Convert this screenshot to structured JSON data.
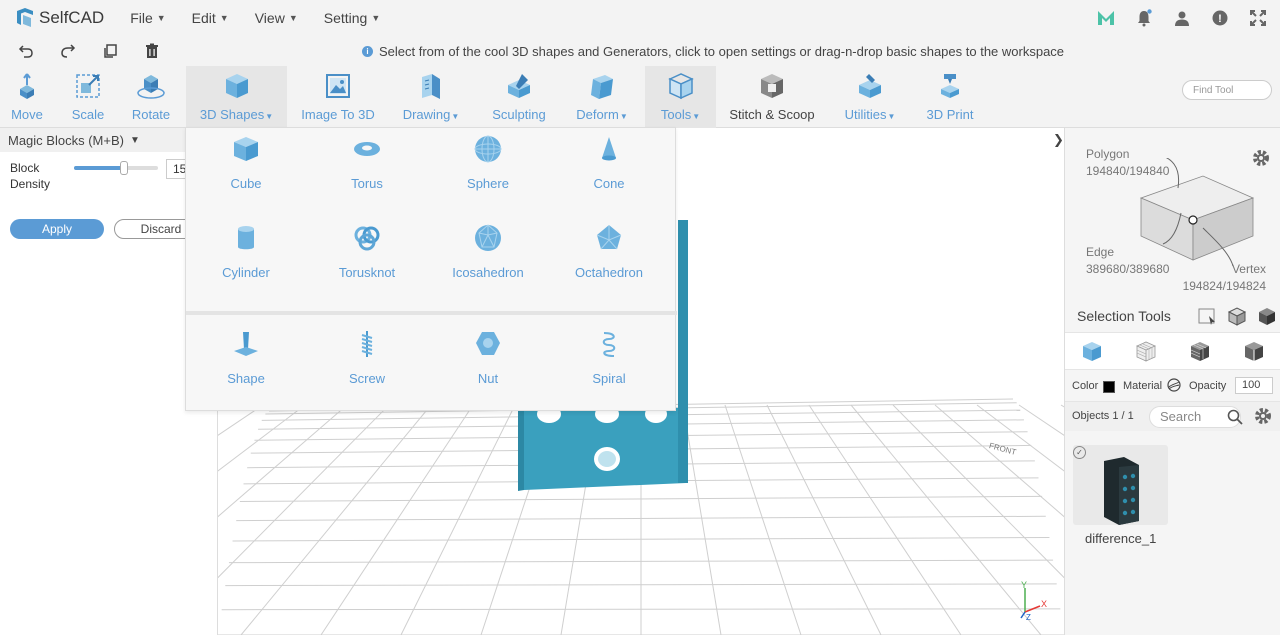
{
  "app": {
    "name": "SelfCAD"
  },
  "menu": [
    {
      "label": "File"
    },
    {
      "label": "Edit"
    },
    {
      "label": "View"
    },
    {
      "label": "Setting"
    }
  ],
  "hint": "Select from of the cool 3D shapes and Generators, click to open settings or drag-n-drop basic shapes to the workspace",
  "toolbar": {
    "move": "Move",
    "scale": "Scale",
    "rotate": "Rotate",
    "shapes": "3D Shapes",
    "image3d": "Image To 3D",
    "drawing": "Drawing",
    "sculpting": "Sculpting",
    "deform": "Deform",
    "tools": "Tools",
    "stitch": "Stitch & Scoop",
    "utilities": "Utilities",
    "print": "3D Print",
    "find_placeholder": "Find Tool"
  },
  "left_panel": {
    "title": "Magic Blocks (M+B)",
    "density_label_1": "Block",
    "density_label_2": "Density",
    "density_value": "15",
    "density_fraction": 0.6,
    "apply": "Apply",
    "discard": "Discard"
  },
  "shapes_menu": {
    "row1": [
      "Cube",
      "Torus",
      "Sphere",
      "Cone"
    ],
    "row2": [
      "Cylinder",
      "Torusknot",
      "Icosahedron",
      "Octahedron"
    ],
    "row3": [
      "Shape",
      "Screw",
      "Nut",
      "Spiral"
    ]
  },
  "right_panel": {
    "polygon_label": "Polygon",
    "polygon_count": "194840/194840",
    "edge_label": "Edge",
    "edge_count": "389680/389680",
    "vertex_label": "Vertex",
    "vertex_count": "194824/194824",
    "selection_tools": "Selection Tools",
    "color_label": "Color",
    "material_label": "Material",
    "opacity_label": "Opacity",
    "opacity_value": "100",
    "objects_count": "Objects 1 / 1",
    "search_placeholder": "Search",
    "object_name": "difference_1"
  },
  "viewport": {
    "axis_y": "Y",
    "axis_x": "X",
    "axis_z": "Z",
    "grid_label": "FRONT"
  },
  "colors": {
    "accent": "#5b9bd5",
    "object": "#3aa0be",
    "toolbar_bg": "#f3f3f3"
  }
}
